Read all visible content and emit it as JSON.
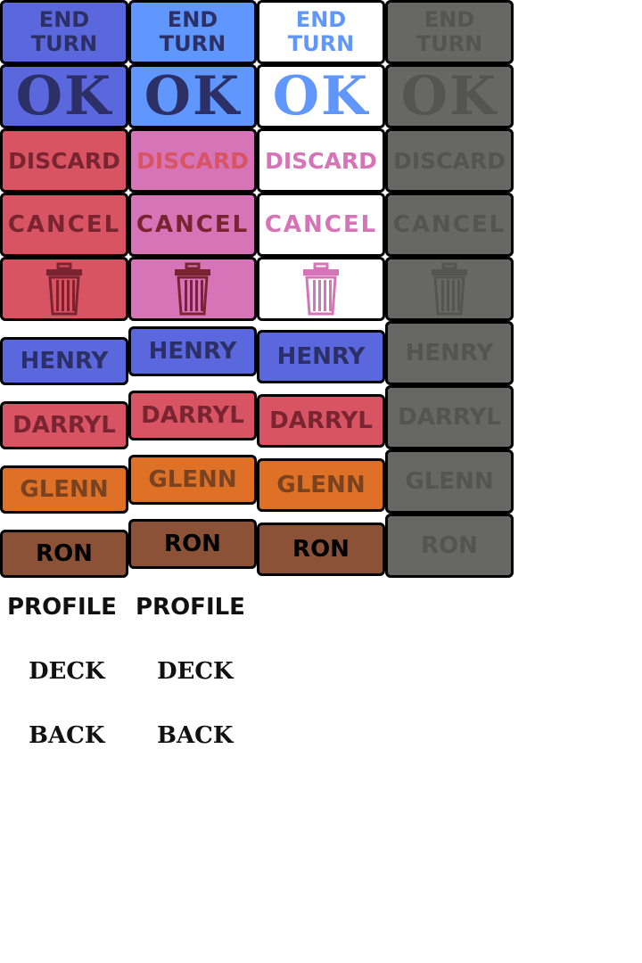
{
  "palette": {
    "blue_dark": "#5b67dc",
    "blue_light": "#5f97fe",
    "navy": "#2c3066",
    "red": "#d95463",
    "pink": "#d674b7",
    "maroon": "#7a2432",
    "white": "#ffffff",
    "gray": "#676866",
    "gray_text": "#545553",
    "orange": "#de7125",
    "orange_text": "#7b4220",
    "brown": "#8b5237",
    "black": "#000000"
  },
  "sheet": {
    "rows": [
      {
        "key": "end_turn",
        "lines": [
          "END",
          "TURN"
        ],
        "style": "end",
        "cells": [
          {
            "variant": "default",
            "bg": "#5b67dc",
            "fg": "#2c3066"
          },
          {
            "variant": "hover",
            "bg": "#5f97fe",
            "fg": "#2c3066"
          },
          {
            "variant": "pressed",
            "bg": "#ffffff",
            "fg": "#5f97fe"
          },
          {
            "variant": "disabled",
            "bg": "#676866",
            "fg": "#545553"
          }
        ]
      },
      {
        "key": "ok",
        "lines": [
          "OK"
        ],
        "style": "ok",
        "cells": [
          {
            "variant": "default",
            "bg": "#5b67dc",
            "fg": "#2c3066"
          },
          {
            "variant": "hover",
            "bg": "#5f97fe",
            "fg": "#2c3066"
          },
          {
            "variant": "pressed",
            "bg": "#ffffff",
            "fg": "#5f97fe"
          },
          {
            "variant": "disabled",
            "bg": "#676866",
            "fg": "#545553"
          }
        ]
      },
      {
        "key": "discard",
        "lines": [
          "DISCARD"
        ],
        "style": "word",
        "cells": [
          {
            "variant": "default",
            "bg": "#d95463",
            "fg": "#7a2432"
          },
          {
            "variant": "hover",
            "bg": "#d674b7",
            "fg": "#d95463"
          },
          {
            "variant": "pressed",
            "bg": "#ffffff",
            "fg": "#d674b7"
          },
          {
            "variant": "disabled",
            "bg": "#676866",
            "fg": "#545553"
          }
        ]
      },
      {
        "key": "cancel",
        "lines": [
          "CANCEL"
        ],
        "style": "cancel",
        "cells": [
          {
            "variant": "default",
            "bg": "#d95463",
            "fg": "#7a2432"
          },
          {
            "variant": "hover",
            "bg": "#d674b7",
            "fg": "#7a2432"
          },
          {
            "variant": "pressed",
            "bg": "#ffffff",
            "fg": "#d674b7"
          },
          {
            "variant": "disabled",
            "bg": "#676866",
            "fg": "#545553"
          }
        ]
      },
      {
        "key": "trash",
        "icon": "trash-can-icon",
        "style": "icon",
        "cells": [
          {
            "variant": "default",
            "bg": "#d95463",
            "fg": "#7a2432"
          },
          {
            "variant": "hover",
            "bg": "#d674b7",
            "fg": "#7a2432"
          },
          {
            "variant": "pressed",
            "bg": "#ffffff",
            "fg": "#d674b7"
          },
          {
            "variant": "disabled",
            "bg": "#676866",
            "fg": "#545553"
          }
        ]
      },
      {
        "key": "henry",
        "lines": [
          "HENRY"
        ],
        "style": "name",
        "cells": [
          {
            "variant": "default",
            "bg": "#5b67dc",
            "fg": "#2c3066"
          },
          {
            "variant": "raised",
            "bg": "#5b67dc",
            "fg": "#2c3066"
          },
          {
            "variant": "selected",
            "bg": "#5b67dc",
            "fg": "#2c3066"
          },
          {
            "variant": "disabled",
            "bg": "#676866",
            "fg": "#545553"
          }
        ]
      },
      {
        "key": "darryl",
        "lines": [
          "DARRYL"
        ],
        "style": "name",
        "cells": [
          {
            "variant": "default",
            "bg": "#d95463",
            "fg": "#7a2432"
          },
          {
            "variant": "raised",
            "bg": "#d95463",
            "fg": "#7a2432"
          },
          {
            "variant": "selected",
            "bg": "#d95463",
            "fg": "#7a2432"
          },
          {
            "variant": "disabled",
            "bg": "#676866",
            "fg": "#545553"
          }
        ]
      },
      {
        "key": "glenn",
        "lines": [
          "GLENN"
        ],
        "style": "name",
        "cells": [
          {
            "variant": "default",
            "bg": "#de7125",
            "fg": "#7b4220"
          },
          {
            "variant": "raised",
            "bg": "#de7125",
            "fg": "#7b4220"
          },
          {
            "variant": "selected",
            "bg": "#de7125",
            "fg": "#7b4220"
          },
          {
            "variant": "disabled",
            "bg": "#676866",
            "fg": "#545553"
          }
        ]
      },
      {
        "key": "ron",
        "lines": [
          "RON"
        ],
        "style": "name",
        "cells": [
          {
            "variant": "default",
            "bg": "#8b5237",
            "fg": "#000000"
          },
          {
            "variant": "raised",
            "bg": "#8b5237",
            "fg": "#000000"
          },
          {
            "variant": "selected",
            "bg": "#8b5237",
            "fg": "#000000"
          },
          {
            "variant": "disabled",
            "bg": "#676866",
            "fg": "#545553"
          }
        ]
      }
    ]
  },
  "bottom_labels": [
    {
      "key": "profile",
      "label": "PROFILE",
      "count": 2
    },
    {
      "key": "deck",
      "label": "DECK",
      "count": 2
    },
    {
      "key": "back",
      "label": "BACK",
      "count": 2
    }
  ]
}
